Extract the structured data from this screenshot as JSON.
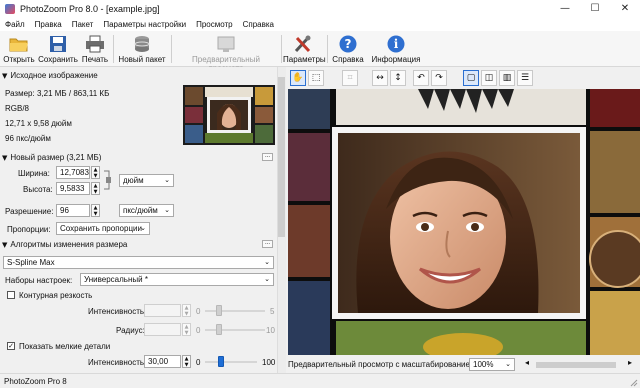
{
  "window": {
    "title": "PhotoZoom Pro 8.0 - [example.jpg]",
    "controls": {
      "minimize": "—",
      "maximize": "☐",
      "close": "✕"
    }
  },
  "menu": [
    "Файл",
    "Правка",
    "Пакет",
    "Параметры настройки",
    "Просмотр",
    "Справка"
  ],
  "toolbar": {
    "open": {
      "label": "Открыть",
      "icon": "folder-icon"
    },
    "save": {
      "label": "Сохранить",
      "icon": "floppy-icon"
    },
    "print": {
      "label": "Печать",
      "icon": "printer-icon"
    },
    "new_batch": {
      "label": "Новый пакет",
      "icon": "batch-icon"
    },
    "preview_settings": {
      "label": "Предварительный просмотр",
      "icon": "preview-icon"
    },
    "settings": {
      "label": "Параметры",
      "icon": "tools-icon"
    },
    "help": {
      "label": "Справка",
      "icon": "help-icon"
    },
    "info": {
      "label": "Информация",
      "icon": "info-icon"
    }
  },
  "source": {
    "header": "Исходное изображение",
    "size": "Размер: 3,21 МБ / 863,11 КБ",
    "mode": "RGB/8",
    "dimensions": "12,71 x 9,58 дюйм",
    "dpi": "96 пкс/дюйм"
  },
  "new_size": {
    "header": "Новый размер (3,21 МБ)",
    "width_label": "Ширина:",
    "width_value": "12,7083",
    "height_label": "Высота:",
    "height_value": "9,5833",
    "unit": "дюйм",
    "resolution_label": "Разрешение:",
    "resolution_value": "96",
    "resolution_unit": "пкс/дюйм",
    "proportions_label": "Пропорции:",
    "proportions_value": "Сохранить пропорции",
    "more": "..."
  },
  "algorithm": {
    "header": "Алгоритмы изменения размера",
    "method": "S-Spline Max",
    "preset_label": "Наборы настроек:",
    "preset_value": "Универсальный *",
    "sharpness_label": "Контурная резкость",
    "sharpness_checked": false,
    "intensity1_label": "Интенсивность:",
    "intensity1_min": "0",
    "intensity1_max": "5",
    "radius_label": "Радиус:",
    "radius_min": "0",
    "radius_max": "10",
    "details_label": "Показать мелкие детали",
    "details_checked": true,
    "details_check_glyph": "✓",
    "intensity2_label": "Интенсивность:",
    "intensity2_value": "30,00",
    "intensity2_min": "0",
    "intensity2_max": "100",
    "intensity2_level": 0.3
  },
  "preview": {
    "zoom_label": "Предварительный просмотр с масштабированием:",
    "zoom_value": "100%"
  },
  "statusbar": {
    "text": "PhotoZoom Pro 8"
  },
  "colors": {
    "accent": "#1e6ed6",
    "background": "#f0f0f0"
  }
}
